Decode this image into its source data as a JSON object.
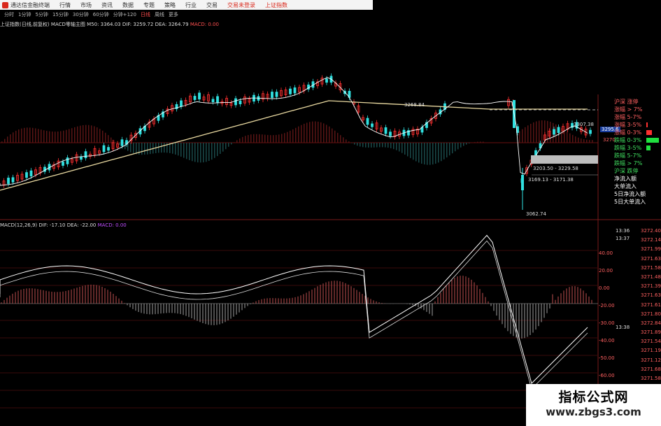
{
  "titlebar": {
    "app_title": "通达信金融终端",
    "menu": [
      "行情",
      "市场",
      "资讯",
      "数据",
      "专题",
      "策略",
      "行业",
      "交易"
    ],
    "alerts": [
      "交易未登录",
      "上证指数"
    ]
  },
  "toolbar": {
    "periods": [
      "分时",
      "1分钟",
      "5分钟",
      "15分钟",
      "30分钟",
      "60分钟",
      "分钟+120",
      "日线",
      "周线",
      "更多"
    ],
    "active": "日线"
  },
  "main_info": {
    "title": "上证指数(日线,前复权)",
    "indicator": "MACD零轴主图",
    "ma50": "M50: 3364.03",
    "dif": "DIF: 3259.72",
    "dea": "DEA: 3264.79",
    "macd": "MACD: 0.00"
  },
  "sub_info": {
    "title": "MACD(12,26,9)",
    "dif": "DIF: -17.10",
    "dea": "DEA: -22.00",
    "macd": "MACD: 0.00"
  },
  "price_annotations": {
    "hi_left": "3268.84",
    "current": "3307.38",
    "box1": "3295.6",
    "left_val": "3270",
    "range1": "3203.50 - 3229.58",
    "range2": "3169.13 - 3171.38",
    "low": "3062.74"
  },
  "right_panel": {
    "items": [
      {
        "label": "沪深 涨停",
        "type": "red",
        "bar": 0
      },
      {
        "label": "涨幅 > 7%",
        "type": "red",
        "bar": 0
      },
      {
        "label": "涨幅 5-7%",
        "type": "red",
        "bar": 0
      },
      {
        "label": "涨幅 3-5%",
        "type": "red",
        "bar": 0.1
      },
      {
        "label": "涨幅 0-3%",
        "type": "red",
        "bar": 0.4
      },
      {
        "label": "跌幅 0-3%",
        "type": "green",
        "bar": 0.9
      },
      {
        "label": "跌幅 3-5%",
        "type": "green",
        "bar": 0.3
      },
      {
        "label": "跌幅 5-7%",
        "type": "green",
        "bar": 0
      },
      {
        "label": "跌幅 > 7%",
        "type": "green",
        "bar": 0
      },
      {
        "label": "沪深 跌停",
        "type": "green",
        "bar": 0
      }
    ],
    "flows": [
      {
        "label": "净流入额",
        "color": "#ffffff"
      },
      {
        "label": "大单流入",
        "color": "#ffffff"
      },
      {
        "label": "5日净流入额",
        "color": "#ffffff"
      },
      {
        "label": "5日大单流入",
        "color": "#ffffff"
      }
    ]
  },
  "macd_axis": [
    "40.00",
    "20.00",
    "0.00",
    "-20.00",
    "-30.00",
    "-40.00",
    "-50.00",
    "-60.00"
  ],
  "ticks": {
    "times": [
      "13:36",
      "13:37",
      "13:38"
    ],
    "prices": [
      "3272.40",
      "3272.14",
      "3271.99",
      "3271.63",
      "3271.58",
      "3271.48",
      "3271.39",
      "3271.63",
      "3271.61",
      "3271.80",
      "3272.84",
      "3271.89",
      "3271.54",
      "3271.19",
      "3271.12",
      "3271.68",
      "3271.58"
    ]
  },
  "watermark": {
    "title": "指标公式网",
    "url": "www.zbgs3.com"
  },
  "colors": {
    "up": "#ff3030",
    "down": "#30e0e0",
    "ma": "#e8d8a0",
    "white": "#ffffff"
  }
}
